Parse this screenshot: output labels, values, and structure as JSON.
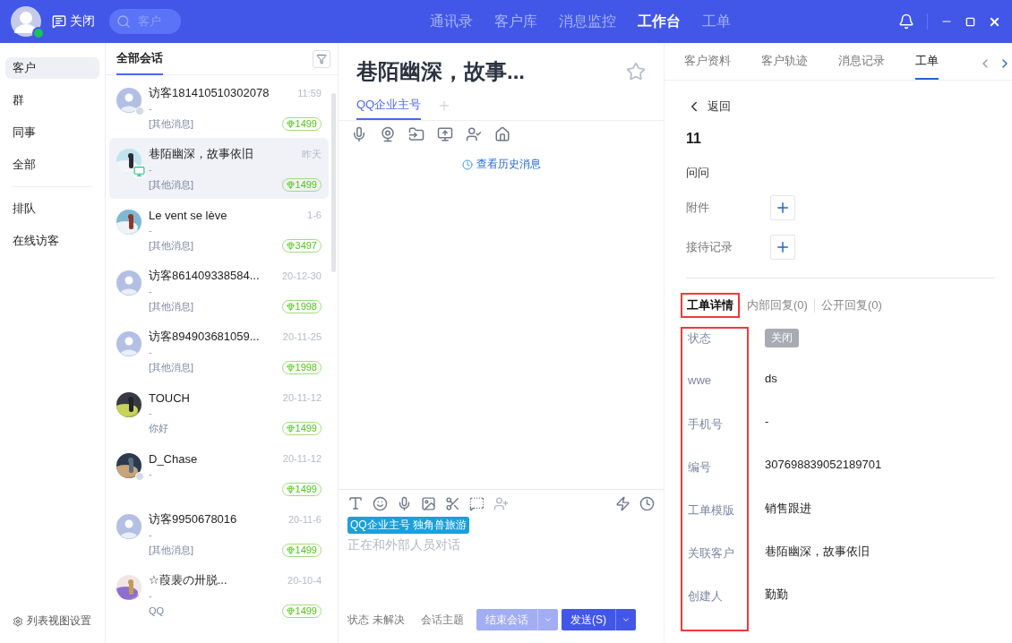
{
  "top_bar": {
    "close_label": "关闭",
    "search": {
      "placeholder": "客户"
    },
    "nav": [
      {
        "label": "通讯录",
        "selected": false
      },
      {
        "label": "客户库",
        "selected": false
      },
      {
        "label": "消息监控",
        "selected": false
      },
      {
        "label": "工作台",
        "selected": true
      },
      {
        "label": "工单",
        "selected": false
      }
    ]
  },
  "sidebar": {
    "items": [
      {
        "label": "客户",
        "selected": true
      },
      {
        "label": "群",
        "selected": false
      },
      {
        "label": "同事",
        "selected": false
      },
      {
        "label": "全部",
        "selected": false
      }
    ],
    "items_secondary": [
      {
        "label": "排队",
        "selected": false
      },
      {
        "label": "在线访客",
        "selected": false
      }
    ],
    "settings_label": "列表视图设置"
  },
  "conversations": {
    "title": "全部会话",
    "items": [
      {
        "name": "访客181410510302078",
        "time": "11:59",
        "line2": "-",
        "message": "[其他消息]",
        "badge": "1499",
        "photo_avatar": false,
        "offline": true,
        "on_pc": false,
        "selected": false
      },
      {
        "name": "巷陌幽深，故事依旧",
        "time": "昨天",
        "line2": "-",
        "message": "[其他消息]",
        "badge": "1499",
        "photo_avatar": true,
        "offline": false,
        "on_pc": true,
        "selected": true
      },
      {
        "name": "Le vent se lève",
        "time": "1-6",
        "line2": "-",
        "message": "[其他消息]",
        "badge": "3497",
        "photo_avatar": true,
        "offline": false,
        "on_pc": false,
        "selected": false
      },
      {
        "name": "访客861409338584...",
        "time": "20-12-30",
        "line2": "-",
        "message": "[其他消息]",
        "badge": "1998",
        "photo_avatar": false,
        "offline": false,
        "on_pc": false,
        "selected": false
      },
      {
        "name": "访客894903681059...",
        "time": "20-11-25",
        "line2": "-",
        "message": "[其他消息]",
        "badge": "1998",
        "photo_avatar": false,
        "offline": false,
        "on_pc": false,
        "selected": false
      },
      {
        "name": "TOUCH",
        "time": "20-11-12",
        "line2": "-",
        "message": "你好",
        "badge": "1499",
        "photo_avatar": true,
        "offline": false,
        "on_pc": false,
        "selected": false
      },
      {
        "name": "D_Chase",
        "time": "20-11-12",
        "line2": "-",
        "badge": "1499",
        "photo_avatar": true,
        "offline": true,
        "on_pc": false,
        "selected": false
      },
      {
        "name": "访客9950678016",
        "time": "20-11-6",
        "line2": "-",
        "message": "[其他消息]",
        "badge": "1499",
        "photo_avatar": false,
        "offline": false,
        "on_pc": false,
        "selected": false
      },
      {
        "name": "☆葭裴の卅脱...",
        "time": "20-10-4",
        "line2": "-",
        "message": "QQ",
        "badge": "1499",
        "photo_avatar": true,
        "offline": false,
        "on_pc": false,
        "selected": false
      }
    ]
  },
  "chat": {
    "title": "巷陌幽深，故事...",
    "channel_tabs": [
      {
        "label": "QQ企业主号",
        "selected": true
      }
    ],
    "history_link": "查看历史消息",
    "tag": "QQ企业主号 独角兽旅游",
    "input": {
      "placeholder": "正在和外部人员对话"
    },
    "status_label": "状态",
    "status_value": "未解决",
    "topic": "会话主题",
    "end_button": "结束会话",
    "send_button": "发送(S)"
  },
  "detail": {
    "tabs": [
      {
        "label": "客户资料",
        "selected": false
      },
      {
        "label": "客户轨迹",
        "selected": false
      },
      {
        "label": "消息记录",
        "selected": false
      },
      {
        "label": "工单",
        "selected": true
      }
    ],
    "back": "返回",
    "ticket_title": "11",
    "description": "问问",
    "attachments": [
      {
        "label": "附件"
      },
      {
        "label": "接待记录"
      }
    ],
    "detail_tabs": [
      {
        "label": "工单详情",
        "selected": true,
        "highlighted": true
      },
      {
        "label": "内部回复(0)",
        "selected": false,
        "highlighted": false
      },
      {
        "label": "公开回复(0)",
        "selected": false,
        "highlighted": false
      }
    ],
    "fields_highlighted": true,
    "fields": [
      {
        "label": "状态",
        "value": "关闭",
        "kind": "tag"
      },
      {
        "label": "wwe",
        "value": "ds",
        "kind": "text"
      },
      {
        "label": "手机号",
        "value": "-",
        "kind": "text"
      },
      {
        "label": "编号",
        "value": "307698839052189701",
        "kind": "text"
      },
      {
        "label": "工单模版",
        "value": "销售跟进",
        "kind": "text"
      },
      {
        "label": "关联客户",
        "value": "巷陌幽深，故事依旧",
        "kind": "text"
      },
      {
        "label": "创建人",
        "value": "勤勤",
        "kind": "text"
      }
    ]
  }
}
